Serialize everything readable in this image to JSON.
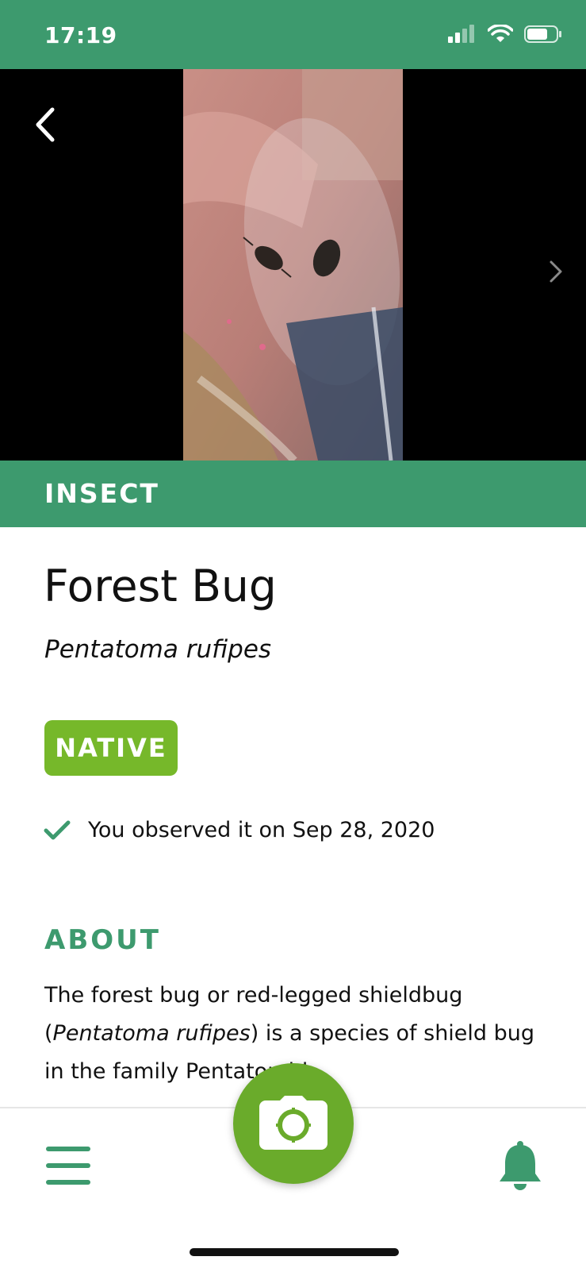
{
  "status_bar": {
    "time": "17:19"
  },
  "category": "INSECT",
  "species": {
    "common_name": "Forest Bug",
    "scientific_name": "Pentatoma rufipes",
    "status_badge": "NATIVE",
    "observation_text": "You observed it on Sep 28, 2020"
  },
  "about": {
    "heading": "ABOUT",
    "text_line1": "The forest bug or red-legged shieldbug",
    "text_open_paren": "(",
    "text_scientific": "Pentatoma rufipes",
    "text_rest": ") is a species of shield bug in the family Pentatomid"
  },
  "icons": {
    "back": "chevron-left-icon",
    "next": "chevron-right-icon",
    "check": "checkmark-icon",
    "menu": "menu-icon",
    "camera": "camera-icon",
    "bell": "bell-icon"
  },
  "colors": {
    "brand_green": "#3d9a6e",
    "native_badge": "#76b82a",
    "camera_button": "#6aab2b"
  }
}
